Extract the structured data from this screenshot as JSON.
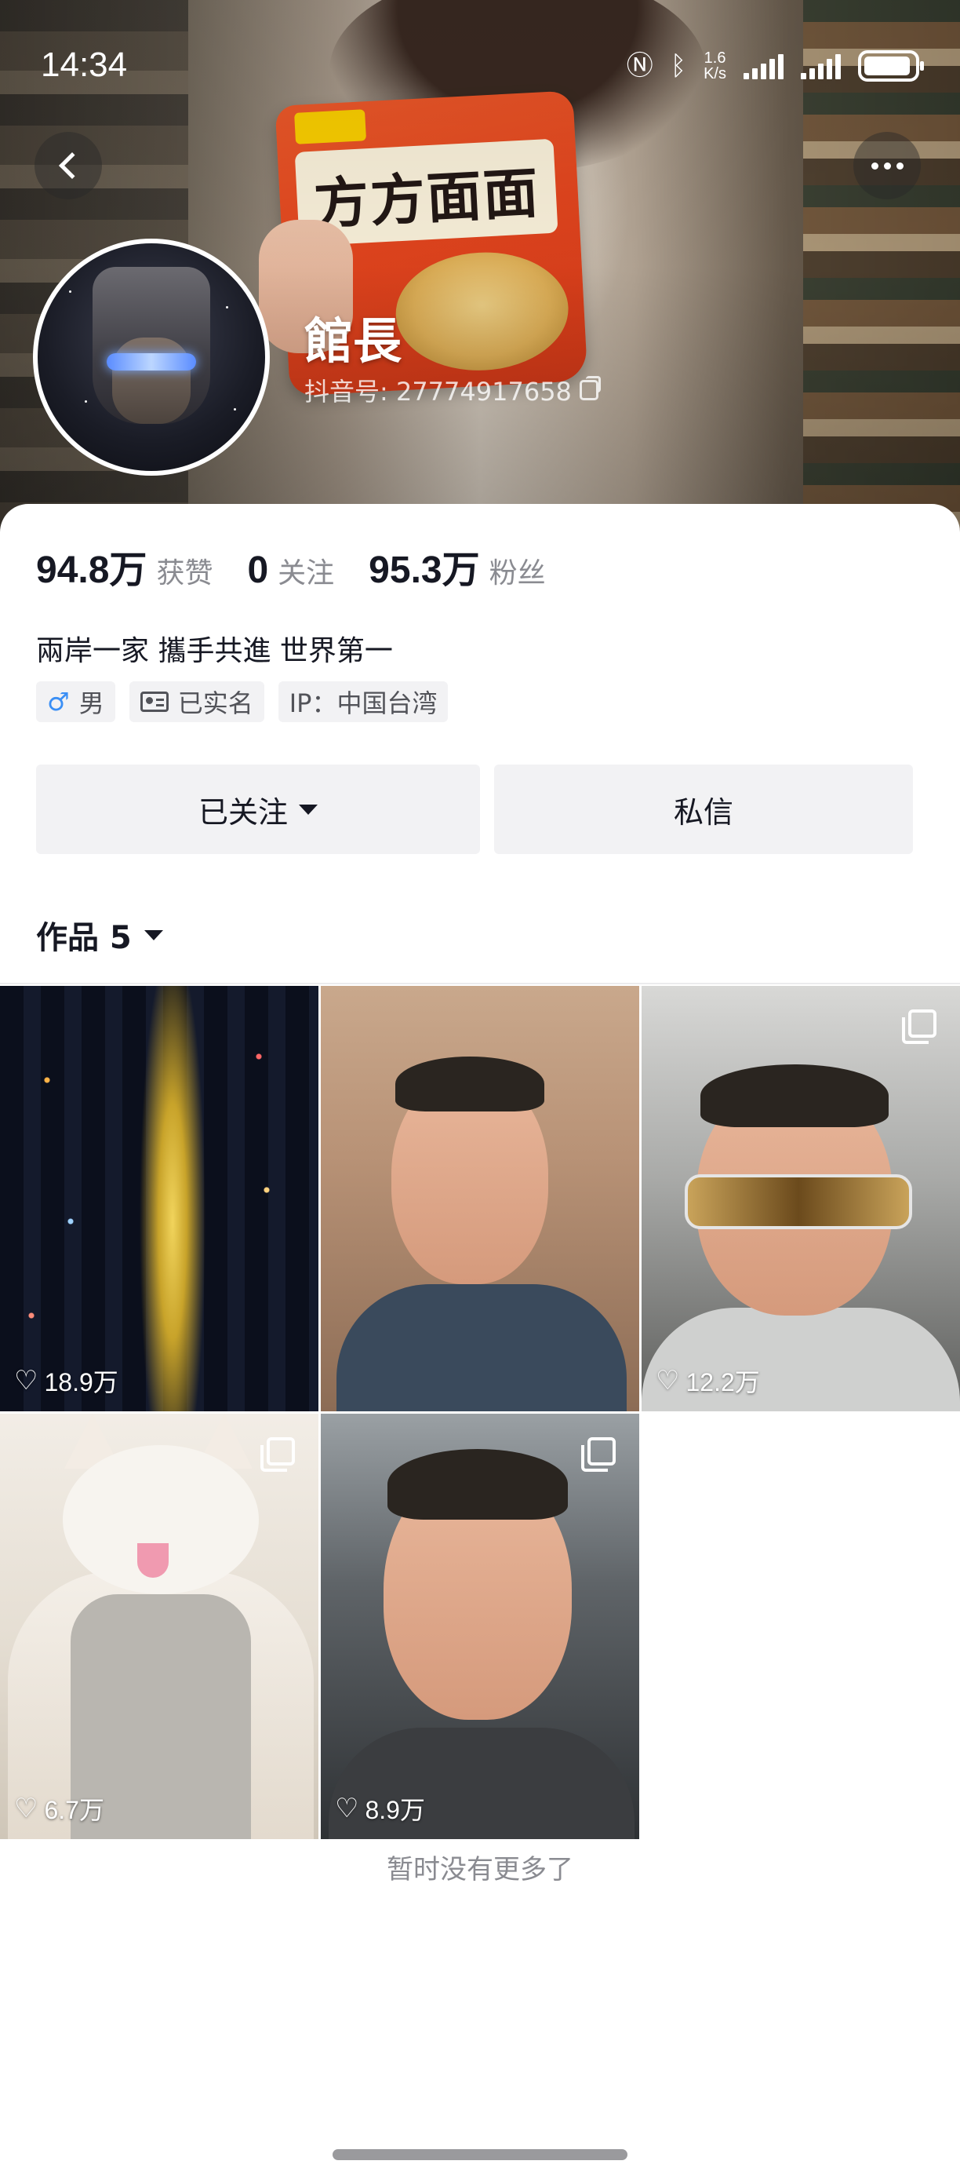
{
  "status_bar": {
    "time": "14:34",
    "net_speed_top": "1.6",
    "net_speed_bottom": "K/s",
    "icons": [
      "nfc-icon",
      "bluetooth-icon",
      "signal-icon",
      "signal-icon",
      "battery-icon"
    ]
  },
  "header": {
    "back_icon": "chevron-left-icon",
    "more_icon": "more-horizontal-icon",
    "username": "館長",
    "douyin_id": "抖音号: 27774917658",
    "cover_text": "方方面面"
  },
  "stats": [
    {
      "value": "94.8万",
      "label": "获赞"
    },
    {
      "value": "0",
      "label": "关注"
    },
    {
      "value": "95.3万",
      "label": "粉丝"
    }
  ],
  "bio": "兩岸一家 攜手共進 世界第一",
  "tags": {
    "gender": "男",
    "verified": "已实名",
    "ip": "IP：中国台湾"
  },
  "actions": {
    "followed_label": "已关注",
    "message_label": "私信"
  },
  "works": {
    "label": "作品 5",
    "items": [
      {
        "likes": "18.9万",
        "multi_image": false,
        "subject": "city-night-aerial"
      },
      {
        "likes": "",
        "multi_image": false,
        "subject": "man-selfie-car"
      },
      {
        "likes": "12.2万",
        "multi_image": true,
        "subject": "man-sunglasses-car"
      },
      {
        "likes": "6.7万",
        "multi_image": true,
        "subject": "muscular-cat-meme"
      },
      {
        "likes": "8.9万",
        "multi_image": true,
        "subject": "man-smiling-car"
      }
    ]
  },
  "footer_text": "暂时没有更多了",
  "colors": {
    "text_primary": "#161823",
    "text_secondary": "#8a8b91",
    "button_bg": "#f2f2f4",
    "male_blue": "#3b8ff5"
  }
}
